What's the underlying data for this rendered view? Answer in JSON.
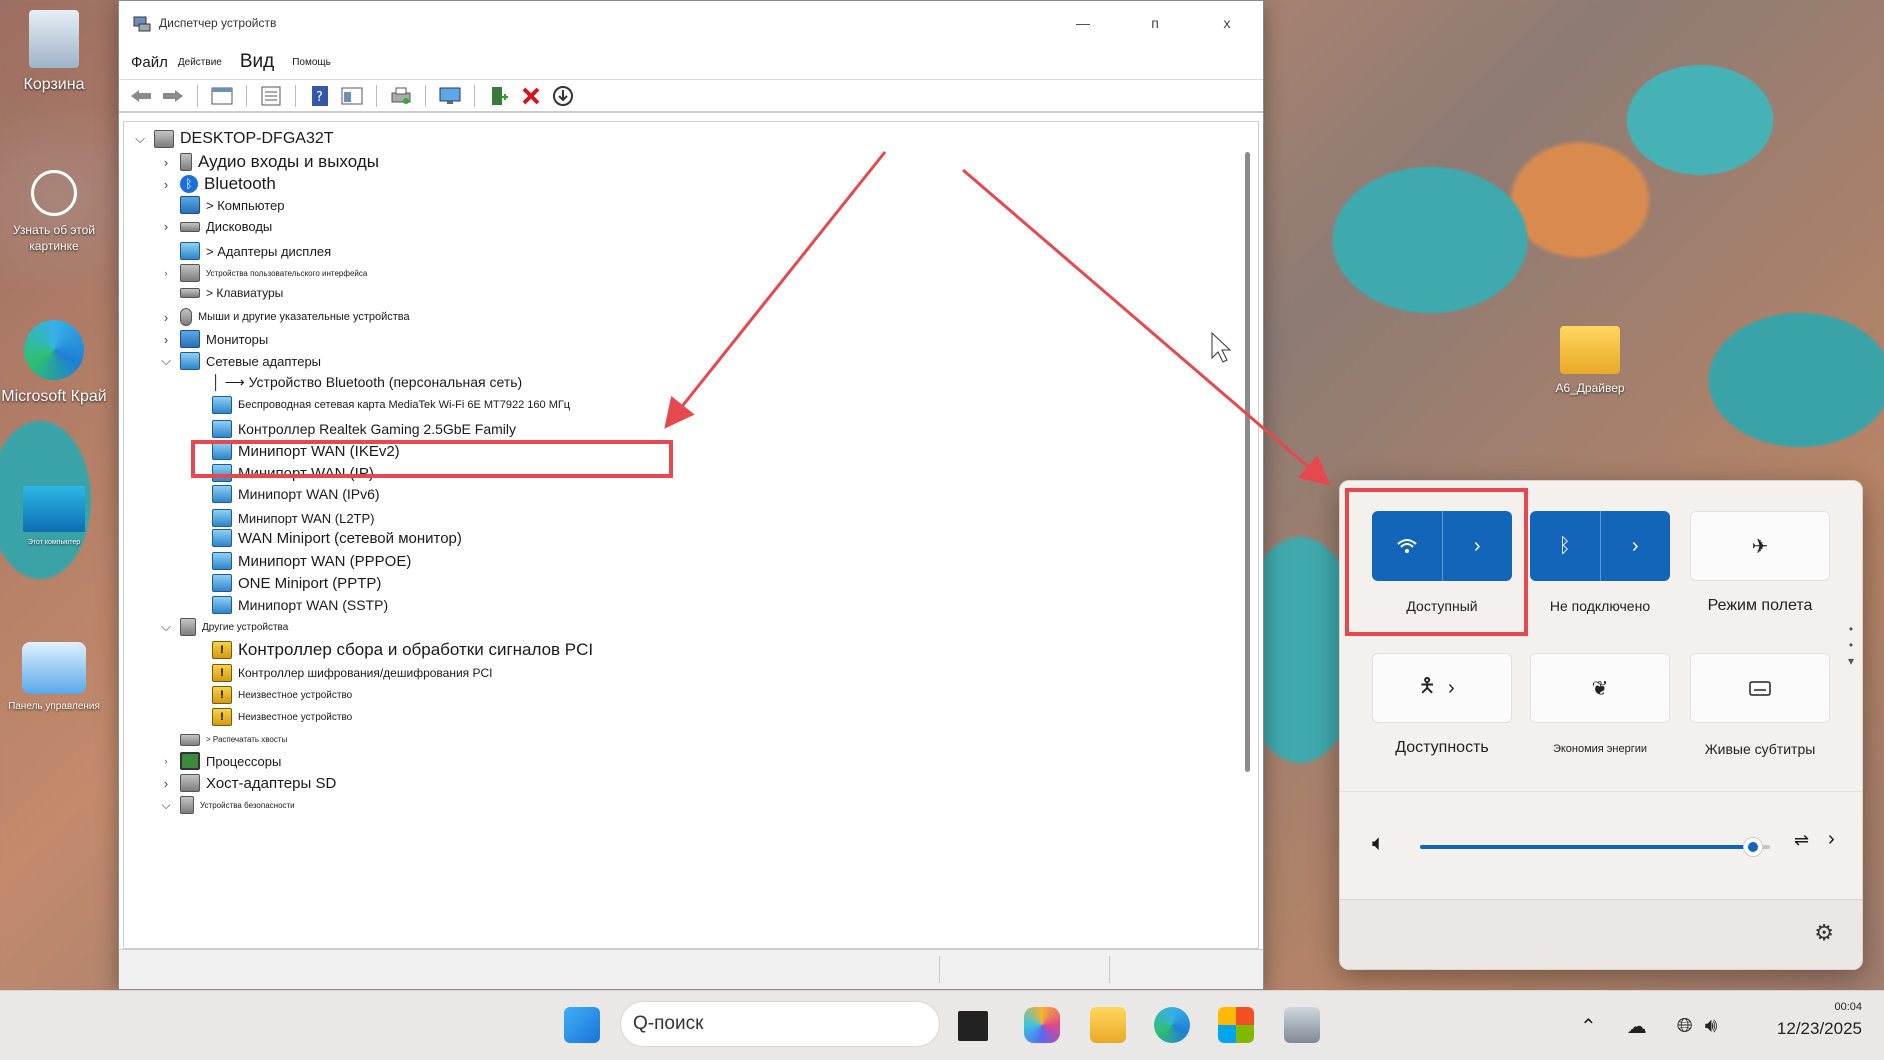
{
  "desktop": {
    "icons": [
      {
        "label": "Корзина"
      },
      {
        "label": "Узнать об этой картинке"
      },
      {
        "label": "Microsoft Край"
      },
      {
        "label": "Этот компьютер"
      },
      {
        "label": "Панель управления"
      },
      {
        "label": "A6_Драйвер"
      }
    ]
  },
  "window": {
    "title": "Диспетчер устройств",
    "controls": {
      "minimize": "—",
      "maximize": "п",
      "close": "x"
    },
    "menu": {
      "file": "Файл",
      "action": "Действие",
      "view": "Вид",
      "help": "Помощь"
    },
    "toolbar_icons": [
      "back-icon",
      "forward-icon",
      "properties-icon",
      "list-icon",
      "help-icon",
      "details-icon",
      "print-icon",
      "monitor-icon",
      "add-driver-icon",
      "delete-icon",
      "download-icon"
    ]
  },
  "tree": {
    "root": "DESKTOP-DFGA32T",
    "audio": "Аудио входы и выходы",
    "bluetooth": "Bluetooth",
    "computer": "> Компьютер",
    "disks": "Дисководы",
    "display": "> Адаптеры дисплея",
    "hid": "Устройства пользовательского интерфейса",
    "keyboards": "> Клавиатуры",
    "mice": "Мыши и другие указательные устройства",
    "monitors": "Мониторы",
    "network": "Сетевые адаптеры",
    "net_children": [
      "│ ⟶ Устройство Bluetooth (персональная сеть)",
      "Беспроводная сетевая карта MediaTek Wi-Fi 6E MT7922 160 МГц",
      "Контроллер Realtek Gaming 2.5GbE Family",
      "Минипорт WAN (IKEv2)",
      "Минипорт WAN (IP)",
      "Минипорт WAN (IPv6)",
      "Минипорт WAN (L2TP)",
      "WAN Miniport (сетевой монитор)",
      "Минипорт WAN (PPPOE)",
      "ONE Miniport (PPTP)",
      "Минипорт WAN (SSTP)"
    ],
    "other": "Другие устройства",
    "other_children": [
      "Контроллер сбора и обработки сигналов PCI",
      "Контроллер шифрования/дешифрования PCI",
      "Неизвестное устройство",
      "Неизвестное устройство"
    ],
    "print_queues": "> Распечатать хвосты",
    "processors": "Процессоры",
    "sd": "Хост-адаптеры SD",
    "security": "Устройства безопасности"
  },
  "quick_settings": {
    "wifi_label": "Доступный",
    "bluetooth_label": "Не подключено",
    "airplane_label": "Режим полета",
    "accessibility_label": "Доступность",
    "energy_label": "Экономия энергии",
    "captions_label": "Живые субтитры",
    "volume_level": 0.95,
    "accent_color": "#1265b8"
  },
  "taskbar": {
    "search_text": "Q-поиск",
    "time": "00:04",
    "date": "12/23/2025"
  },
  "annotation_color": "#e5484d"
}
